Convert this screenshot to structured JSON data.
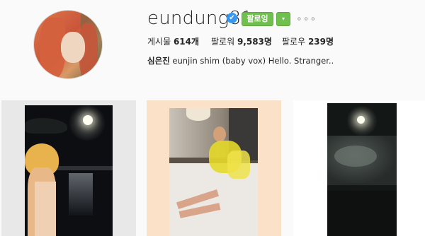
{
  "profile": {
    "username": "eundung81",
    "verified_mark": "✔",
    "follow_label": "팔로잉",
    "dropdown_icon": "▾",
    "more_icon": "∘∘∘",
    "stats": {
      "posts_label": "게시물",
      "posts_value": "614개",
      "followers_label": "팔로워",
      "followers_value": "9,583명",
      "following_label": "팔로우",
      "following_value": "239명"
    },
    "bio": {
      "name": "심은진",
      "text": "eunjin shim (baby vox) Hello. Stranger.."
    }
  },
  "colors": {
    "follow_green": "#70c050",
    "verified_blue": "#3897f0"
  },
  "icons": [
    "verified-badge-icon",
    "chevron-down-icon",
    "more-options-icon"
  ],
  "posts": [
    {
      "id": "post-1",
      "description_icon": "moon-night-sea-photo"
    },
    {
      "id": "post-2",
      "description_icon": "woman-on-bed-photo"
    },
    {
      "id": "post-3",
      "description_icon": "moon-clouds-sea-photo"
    }
  ]
}
